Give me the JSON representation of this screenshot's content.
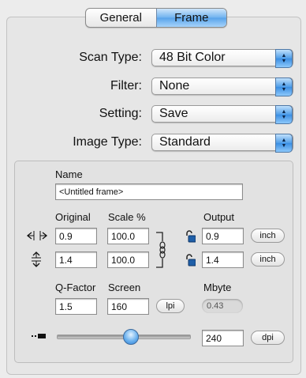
{
  "tabs": [
    {
      "label": "General"
    },
    {
      "label": "Frame"
    }
  ],
  "selected_tab": "Frame",
  "popups": {
    "scan_type": {
      "label": "Scan Type:",
      "value": "48 Bit Color"
    },
    "filter": {
      "label": "Filter:",
      "value": "None"
    },
    "setting": {
      "label": "Setting:",
      "value": "Save"
    },
    "image_type": {
      "label": "Image Type:",
      "value": "Standard"
    }
  },
  "frame": {
    "name_label": "Name",
    "name_value": "<Untitled frame>",
    "original_label": "Original",
    "scale_label": "Scale %",
    "output_label": "Output",
    "width": {
      "original": "0.9",
      "scale": "100.0",
      "output": "0.9",
      "unit": "inch"
    },
    "height": {
      "original": "1.4",
      "scale": "100.0",
      "output": "1.4",
      "unit": "inch"
    },
    "qfactor_label": "Q-Factor",
    "qfactor_value": "1.5",
    "screen_label": "Screen",
    "screen_value": "160",
    "screen_unit": "lpi",
    "mbyte_label": "Mbyte",
    "mbyte_value": "0.43",
    "resolution_value": "240",
    "resolution_unit": "dpi",
    "resolution_slider_fraction": 0.56
  },
  "colors": {
    "accent": "#4d9ce8"
  }
}
